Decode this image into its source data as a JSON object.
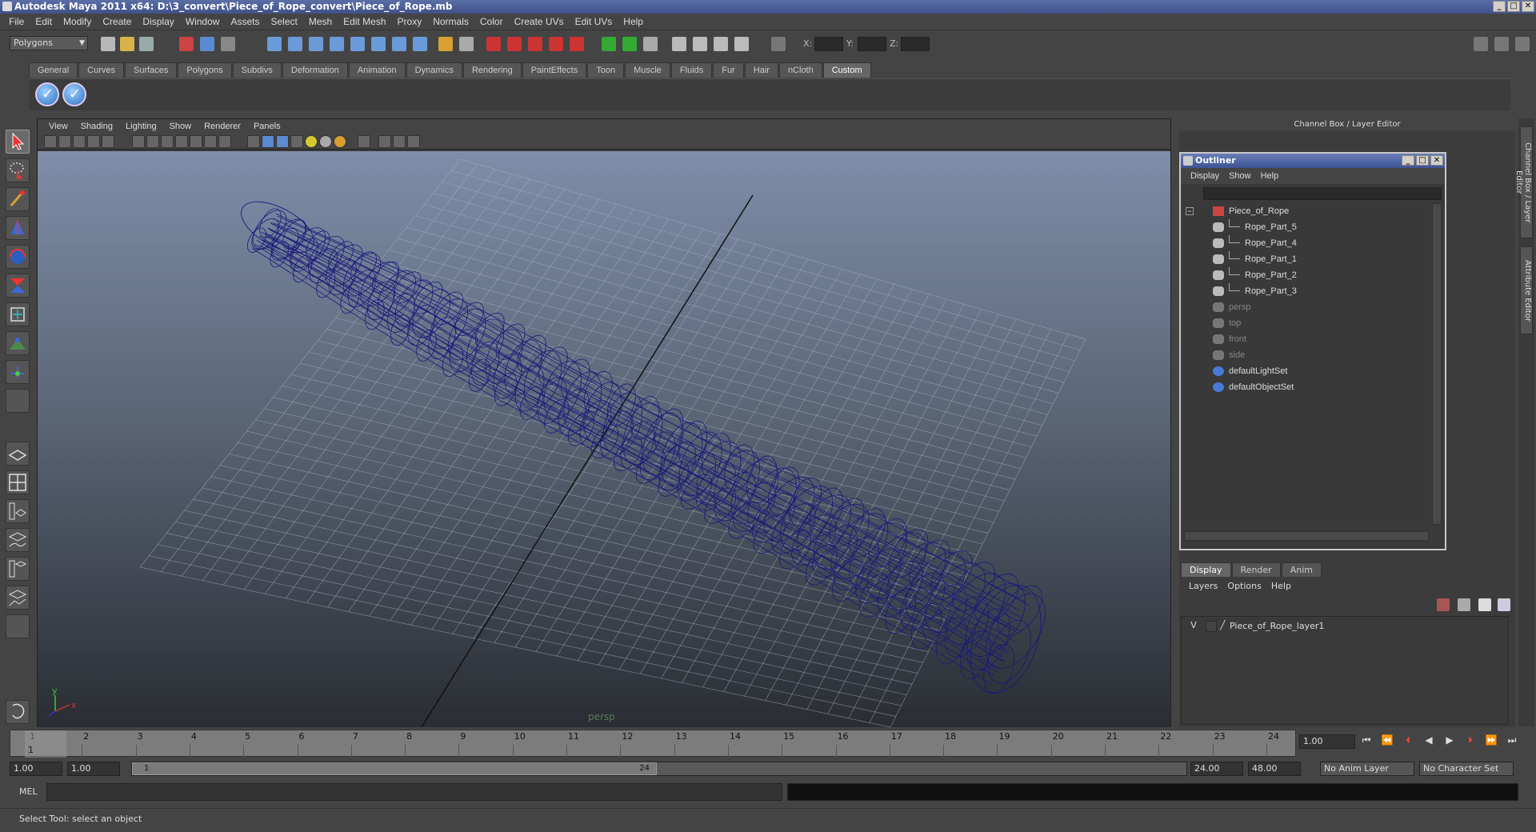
{
  "window": {
    "title": "Autodesk Maya 2011 x64: D:\\3_convert\\Piece_of_Rope_convert\\Piece_of_Rope.mb"
  },
  "menubar": [
    "File",
    "Edit",
    "Modify",
    "Create",
    "Display",
    "Window",
    "Assets",
    "Select",
    "Mesh",
    "Edit Mesh",
    "Proxy",
    "Normals",
    "Color",
    "Create UVs",
    "Edit UVs",
    "Help"
  ],
  "statusline": {
    "mode": "Polygons",
    "x_label": "X:",
    "y_label": "Y:",
    "z_label": "Z:"
  },
  "shelf": {
    "tabs": [
      "General",
      "Curves",
      "Surfaces",
      "Polygons",
      "Subdivs",
      "Deformation",
      "Animation",
      "Dynamics",
      "Rendering",
      "PaintEffects",
      "Toon",
      "Muscle",
      "Fluids",
      "Fur",
      "Hair",
      "nCloth",
      "Custom"
    ],
    "active_tab": "Custom"
  },
  "viewport": {
    "menus": [
      "View",
      "Shading",
      "Lighting",
      "Show",
      "Renderer",
      "Panels"
    ],
    "camera_label": "persp",
    "axis_x": "x",
    "axis_y": "y"
  },
  "channelbox": {
    "header": "Channel Box / Layer Editor"
  },
  "sidetabs": [
    "Channel Box / Layer Editor",
    "Attribute Editor"
  ],
  "outliner": {
    "title": "Outliner",
    "menus": [
      "Display",
      "Show",
      "Help"
    ],
    "items": [
      {
        "label": "Piece_of_Rope",
        "dim": false
      },
      {
        "label": "Rope_Part_5",
        "dim": false
      },
      {
        "label": "Rope_Part_4",
        "dim": false
      },
      {
        "label": "Rope_Part_1",
        "dim": false
      },
      {
        "label": "Rope_Part_2",
        "dim": false
      },
      {
        "label": "Rope_Part_3",
        "dim": false
      },
      {
        "label": "persp",
        "dim": true
      },
      {
        "label": "top",
        "dim": true
      },
      {
        "label": "front",
        "dim": true
      },
      {
        "label": "side",
        "dim": true
      },
      {
        "label": "defaultLightSet",
        "dim": false
      },
      {
        "label": "defaultObjectSet",
        "dim": false
      }
    ]
  },
  "layereditor": {
    "tabs": [
      "Display",
      "Render",
      "Anim"
    ],
    "menus": [
      "Layers",
      "Options",
      "Help"
    ],
    "layer": {
      "visible": "V",
      "name": "Piece_of_Rope_layer1"
    }
  },
  "timeslider": {
    "ticks": [
      "1",
      "2",
      "3",
      "4",
      "5",
      "6",
      "7",
      "8",
      "9",
      "10",
      "11",
      "12",
      "13",
      "14",
      "15",
      "16",
      "17",
      "18",
      "19",
      "20",
      "21",
      "22",
      "23",
      "24"
    ],
    "current_frame_marker": "1",
    "current_frame": "1.00"
  },
  "rangeslider": {
    "start_time": "1.00",
    "playback_start": "1.00",
    "range_start_label": "1",
    "range_end_label": "24",
    "playback_end": "24.00",
    "end_time": "48.00",
    "anim_layer": "No Anim Layer",
    "character_set": "No Character Set"
  },
  "cmdline": {
    "label": "MEL"
  },
  "helpline": {
    "text": "Select Tool: select an object"
  },
  "colors": {
    "wire": "#1a1a7a",
    "title": "#3e5188"
  }
}
